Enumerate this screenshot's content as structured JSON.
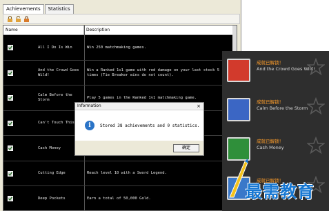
{
  "tabs": [
    {
      "label": "Achievements"
    },
    {
      "label": "Statistics"
    }
  ],
  "table": {
    "columns": [
      "Name",
      "Description"
    ],
    "rows": [
      {
        "name": "All I Do Is Win",
        "description": "Win 250 matchmaking games."
      },
      {
        "name": "And the Crowd Goes Wild!",
        "description": "Win a Ranked 1v1 game with red damage on your last stock 5 times (Tie Breaker wins do not count)."
      },
      {
        "name": "Calm Before the Storm",
        "description": "Play 5 games in the Ranked 1v1 matchmaking game."
      },
      {
        "name": "Can't Touch This",
        "description": ""
      },
      {
        "name": "Cash Money",
        "description": ""
      },
      {
        "name": "Cutting Edge",
        "description": "Reach level 10 with a Sword Legend."
      },
      {
        "name": "Deep Pockets",
        "description": "Earn a total of 50,000 Gold."
      }
    ]
  },
  "dialog": {
    "title": "Information",
    "close": "×",
    "message": "Stored 38 achievements and 0 statistics.",
    "ok_label": "确定"
  },
  "notifications": [
    {
      "title": "成就已解锁！",
      "text": "And the Crowd Goes Wild!",
      "icon": "crowd-achievement-icon",
      "color": "#d23a2c"
    },
    {
      "title": "成就已解锁！",
      "text": "Calm Before the Storm",
      "icon": "storm-achievement-icon",
      "color": "#3b66c4"
    },
    {
      "title": "成就已解锁！",
      "text": "Cash Money",
      "icon": "cash-achievement-icon",
      "color": "#2f8f3a"
    },
    {
      "title": "成就已解锁！",
      "text": "",
      "icon": "achievement-icon",
      "color": "#3a78c9"
    }
  ],
  "watermark": {
    "text": "最需教育"
  },
  "colors": {
    "accent": "#ff9e2a",
    "grid_bg": "#000000",
    "dialog_info": "#2b74c7",
    "watermark": "#1677d2"
  }
}
